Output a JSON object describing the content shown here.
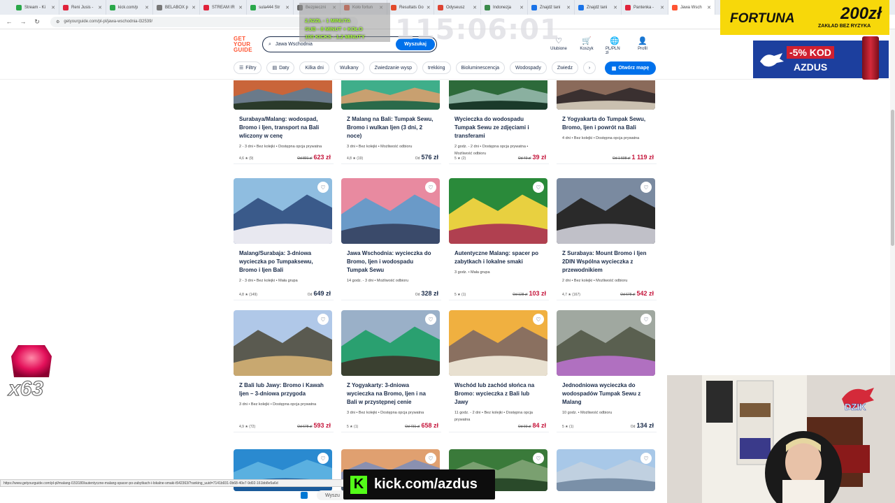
{
  "browser": {
    "tabs": [
      {
        "label": "Stream - Ki",
        "color": "#2aa84a"
      },
      {
        "label": "Reni Jusis -",
        "color": "#e0233b"
      },
      {
        "label": "kick.com/p",
        "color": "#2aa84a"
      },
      {
        "label": "BELABOX p",
        "color": "#777777"
      },
      {
        "label": "STREAM IR",
        "color": "#e0233b"
      },
      {
        "label": "sula444 Str",
        "color": "#2aa84a"
      },
      {
        "label": "Bezpieczni",
        "color": "#6a6a6a"
      },
      {
        "label": "Koło fortun",
        "color": "#e24a2a"
      },
      {
        "label": "Resultats Go",
        "color": "#e24a2a"
      },
      {
        "label": "Odyseusz",
        "color": "#d43"
      },
      {
        "label": "Indonezja",
        "color": "#3a8a4a"
      },
      {
        "label": "Znajdź tani",
        "color": "#1a73e8"
      },
      {
        "label": "Znajdź tani",
        "color": "#1a73e8"
      },
      {
        "label": "Pantenka -",
        "color": "#e0233b"
      },
      {
        "label": "Jawa Wsch",
        "color": "#ff5533"
      }
    ],
    "url": "getyourguide.com/pl-pl/jawa-wschodnia-l32539/"
  },
  "header": {
    "logo": [
      "GET",
      "YOUR",
      "GUIDE"
    ],
    "search_value": "Jawa Wschodnia",
    "search_button": "Wyszukaj",
    "icons": [
      {
        "glyph": "♡",
        "label": "Ulubione",
        "name": "favorites-icon"
      },
      {
        "glyph": "🛒",
        "label": "Koszyk",
        "name": "cart-icon"
      },
      {
        "glyph": "🌐",
        "label": "PL/PLN zł",
        "name": "globe-icon"
      },
      {
        "glyph": "👤",
        "label": "Profil",
        "name": "profile-icon"
      }
    ],
    "chips": [
      "Filtry",
      "Daty",
      "Kilka dni",
      "Wulkany",
      "Zwiedzanie wysp",
      "trekking",
      "Bioluminescencja",
      "Wodospady",
      "Zwiedz"
    ],
    "map_button": "Otwórz mapę"
  },
  "cards_row1": [
    {
      "title": "Surabaya/Malang: wodospad, Bromo i Ijen, transport na Bali wliczony w cenę",
      "meta": "2 - 3 dni • Bez kolejki • Dostępna opcja prywatna",
      "rating": "4,6 ★ (9)",
      "old": "Od 891 zł",
      "price": "623 zł",
      "red": true
    },
    {
      "title": "Z Malang na Bali: Tumpak Sewu, Bromo i wulkan Ijen (3 dni, 2 noce)",
      "meta": "3 dni • Bez kolejki • Możliwość odbioru",
      "rating": "4,8 ★ (19)",
      "old": "Od",
      "price": "576 zł",
      "red": false
    },
    {
      "title": "Wycieczka do wodospadu Tumpak Sewu ze zdjęciami i transferami",
      "meta": "2 godz. - 2 dni • Dostępna opcja prywatna • Możliwość odbioru",
      "rating": "5 ★ (2)",
      "old": "Od 49 zł",
      "price": "39 zł",
      "red": true
    },
    {
      "title": "Z Yogyakarta do Tumpak Sewu, Bromo, Ijen i powrót na Bali",
      "meta": "4 dni • Bez kolejki • Dostępna opcja prywatna",
      "rating": "",
      "old": "Od 1 598 zł",
      "price": "1 119 zł",
      "red": true
    }
  ],
  "cards_row2": [
    {
      "title": "Malang/Surabaja: 3-dniowa wycieczka po Tumpaksewu, Bromo i Ijen Bali",
      "meta": "2 - 3 dni • Bez kolejki • Mała grupa",
      "rating": "4,8 ★ (149)",
      "old": "Od",
      "price": "649 zł",
      "red": false
    },
    {
      "title": "Jawa Wschodnia: wycieczka do Bromo, Ijen i wodospadu Tumpak Sewu",
      "meta": "14 godz. - 3 dni • Możliwość odbioru",
      "rating": "",
      "old": "Od",
      "price": "328 zł",
      "red": false
    },
    {
      "title": "Autentyczne Malang: spacer po zabytkach i lokalne smaki",
      "meta": "3 godz. • Mała grupa",
      "rating": "5 ★ (1)",
      "old": "Od 128 zł",
      "price": "103 zł",
      "red": true
    },
    {
      "title": "Z Surabaya: Mount Bromo i Ijen 2DIN Wspólna wycieczka z przewodnikiem",
      "meta": "2 dni • Bez kolejki • Możliwość odbioru",
      "rating": "4,7 ★ (167)",
      "old": "Od 678 zł",
      "price": "542 zł",
      "red": true
    }
  ],
  "cards_row3": [
    {
      "title": "Z Bali lub Jawy: Bromo i Kawah Ijen – 3-dniowa przygoda",
      "meta": "3 dni • Bez kolejki • Dostępna opcja prywatna",
      "rating": "4,9 ★ (72)",
      "old": "Od 678 zł",
      "price": "593 zł",
      "red": true
    },
    {
      "title": "Z Yogyakarty: 3-dniowa wycieczka na Bromo, Ijen i na Bali w przystępnej cenie",
      "meta": "3 dni • Bez kolejki • Dostępna opcja prywatna",
      "rating": "5 ★ (1)",
      "old": "Od 731 zł",
      "price": "658 zł",
      "red": true
    },
    {
      "title": "Wschód lub zachód słońca na Bromo: wycieczka z Bali lub Jawy",
      "meta": "11 godz. - 2 dni • Bez kolejki • Dostępna opcja prywatna",
      "rating": "",
      "old": "Od 93 zł",
      "price": "84 zł",
      "red": true
    },
    {
      "title": "Jednodniowa wycieczka do wodospadów Tumpak Sewu z Malang",
      "meta": "10 godz. • Możliwość odbioru",
      "rating": "5 ★ (1)",
      "old": "Od",
      "price": "134 zł",
      "red": false
    }
  ],
  "overlay": {
    "timer": "115:06:01",
    "sub_lines": [
      "2,52ZŁ - 1 MINUTA",
      "SUB - 8 MINUT + KOŁO",
      "100 KICKS - 1.2 MINUTY"
    ],
    "fortuna_brand": "FORTUNA",
    "fortuna_amount": "200zł",
    "fortuna_sub": "ZAKŁAD BEZ RYZYKA",
    "promo_code_pct": "-5% KOD",
    "promo_code": "AZDUS",
    "multiplier": "x63",
    "kick_url": "kick.com/azdus",
    "taskbar_search": "Wyszu",
    "status_url": "https://www.getyourguide.com/pl-pl/malang-l153180/autentyczne-malang-spacer-po-zabytkach-i-lokalne-smaki-t542363/?ranking_uuid=7141b931-0b68-40e7-9d02-161bb8e5a6d"
  }
}
